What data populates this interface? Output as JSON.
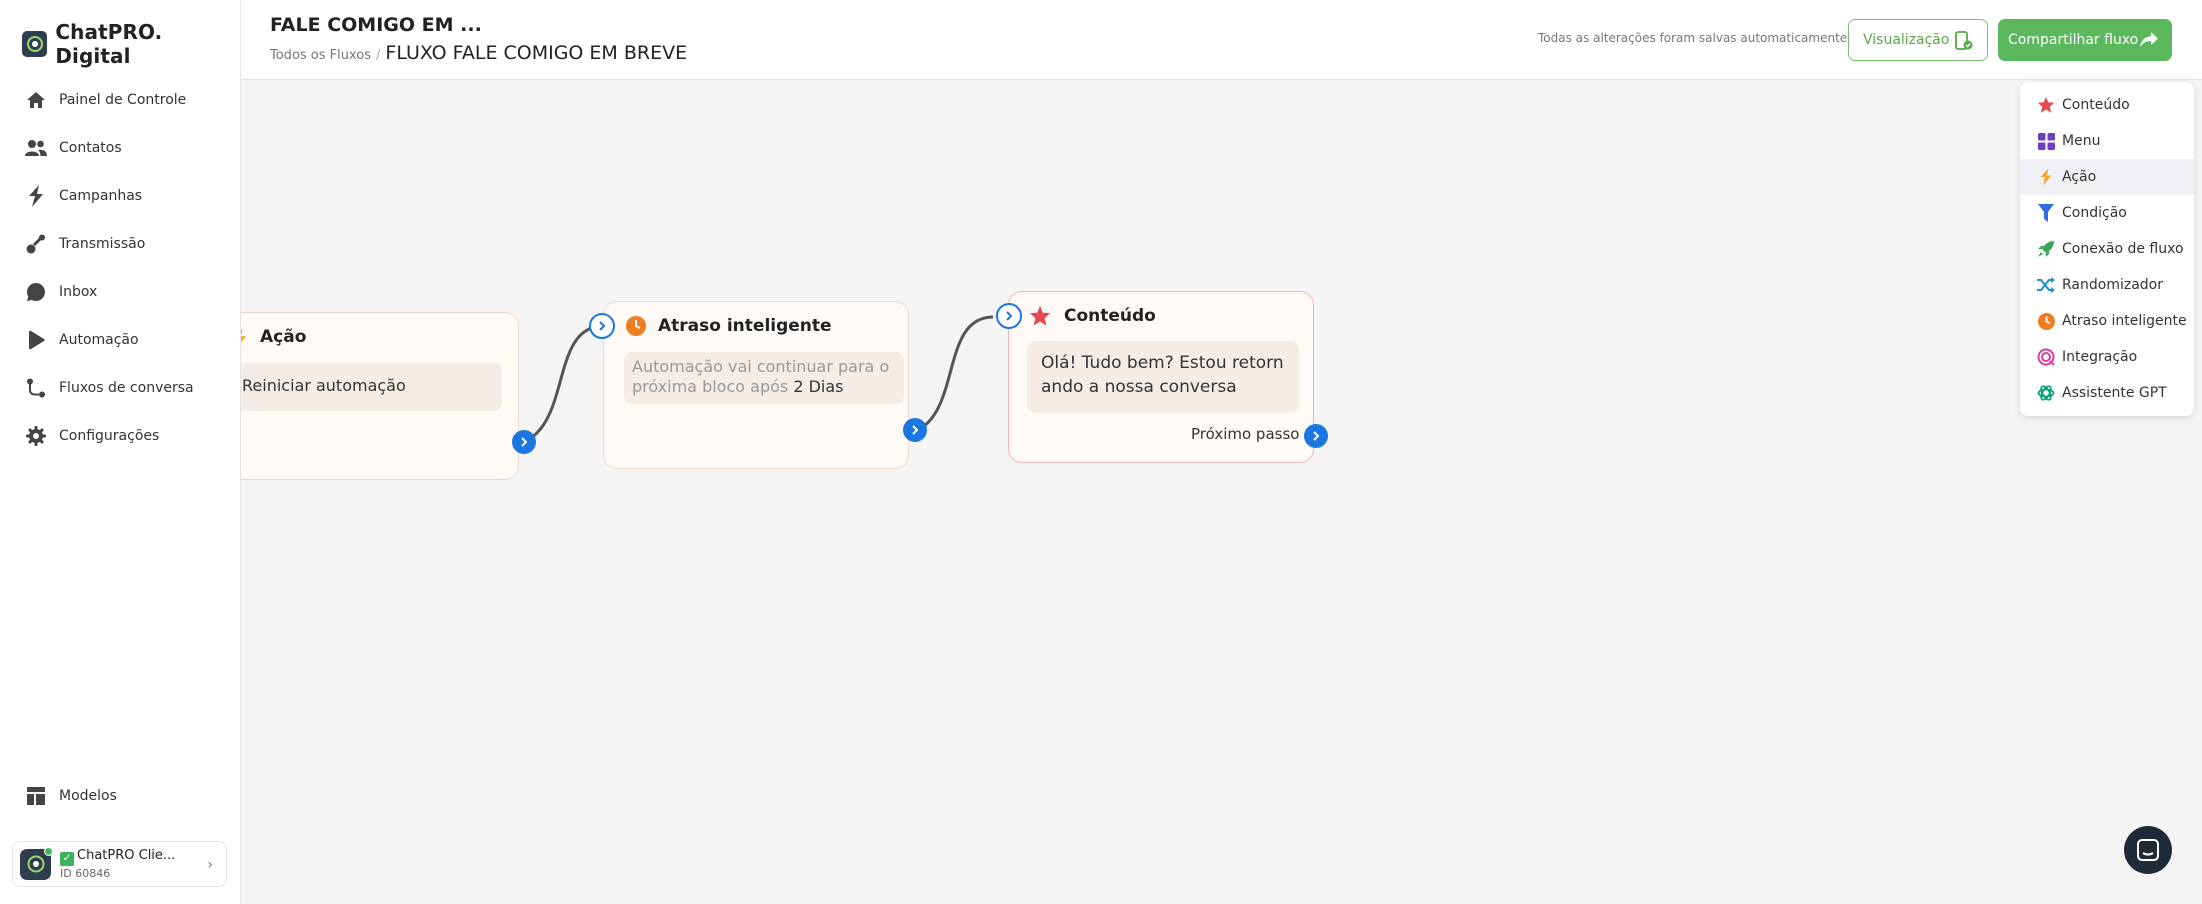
{
  "brand": {
    "name": "ChatPRO. Digital"
  },
  "sidebar": {
    "items": [
      {
        "label": "Painel de Controle",
        "icon": "home-icon"
      },
      {
        "label": "Contatos",
        "icon": "users-icon"
      },
      {
        "label": "Campanhas",
        "icon": "bolt-icon"
      },
      {
        "label": "Transmissão",
        "icon": "broadcast-icon"
      },
      {
        "label": "Inbox",
        "icon": "chat-bubble-icon"
      },
      {
        "label": "Automação",
        "icon": "play-icon"
      },
      {
        "label": "Fluxos de conversa",
        "icon": "flow-icon"
      },
      {
        "label": "Configurações",
        "icon": "gear-icon"
      }
    ],
    "bottom_item": {
      "label": "Modelos",
      "icon": "templates-icon"
    },
    "account": {
      "name": "ChatPRO Clie...",
      "id": "ID 60846"
    }
  },
  "header": {
    "title": "FALE COMIGO EM ...",
    "breadcrumb_root": "Todos os Fluxos",
    "breadcrumb_sep": "/",
    "breadcrumb_current": "FLUXO FALE COMIGO EM BREVE",
    "saved_note": "Todas as alterações foram salvas automaticamente",
    "preview_label": "Visualização",
    "share_label": "Compartilhar fluxo"
  },
  "canvas": {
    "nodes": [
      {
        "title": "Ação",
        "body": "Reiniciar automação",
        "icon": "bolt-icon"
      },
      {
        "title": "Atraso inteligente",
        "body_prefix": "Automação vai continuar para o próxima bloco após",
        "body_value": "2 Dias",
        "icon": "clock-icon"
      },
      {
        "title": "Conteúdo",
        "body": "Olá! Tudo bem? Estou retornando a nossa conversa",
        "next_label": "Próximo passo",
        "icon": "star-icon"
      }
    ]
  },
  "add_menu": {
    "items": [
      {
        "label": "Conteúdo",
        "icon": "star-icon",
        "color": "#e5484d"
      },
      {
        "label": "Menu",
        "icon": "grid-icon",
        "color": "#6c3fc5"
      },
      {
        "label": "Ação",
        "icon": "bolt-icon",
        "color": "#f5a524"
      },
      {
        "label": "Condição",
        "icon": "filter-icon",
        "color": "#2f6fdc"
      },
      {
        "label": "Conexão de fluxo",
        "icon": "rocket-icon",
        "color": "#3aa655"
      },
      {
        "label": "Randomizador",
        "icon": "shuffle-icon",
        "color": "#1e90d6"
      },
      {
        "label": "Atraso inteligente",
        "icon": "clock-icon",
        "color": "#ef7d22"
      },
      {
        "label": "Integração",
        "icon": "integration-icon",
        "color": "#d63fa0"
      },
      {
        "label": "Assistente GPT",
        "icon": "gpt-icon",
        "color": "#10a37f"
      }
    ],
    "active_index": 2
  }
}
